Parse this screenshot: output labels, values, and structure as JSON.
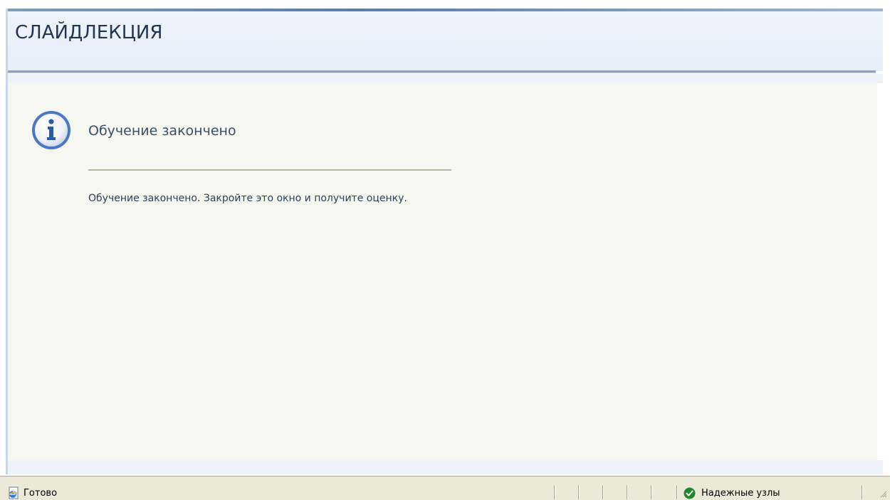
{
  "header": {
    "title": "СЛАЙДЛЕКЦИЯ"
  },
  "message": {
    "icon": "info-icon",
    "title": "Обучение закончено",
    "body": "Обучение закончено. Закройте это окно и получите оценку."
  },
  "statusbar": {
    "status_text": "Готово",
    "status_icon": "ie-page-icon",
    "zone_text": "Надежные узлы",
    "zone_icon": "green-check-icon"
  },
  "colors": {
    "header_bg": "#e6eef8",
    "content_bg": "#f7f7f2",
    "statusbar_bg": "#ece9d8",
    "accent_blue": "#4a78c2",
    "zone_green": "#1d8a2b"
  }
}
